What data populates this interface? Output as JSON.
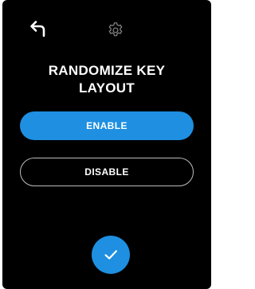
{
  "colors": {
    "background": "#000000",
    "accent": "#1e8fe1",
    "text": "#ffffff",
    "outline": "#bcbcbc"
  },
  "header": {
    "back_icon": "back-arrow-icon",
    "settings_icon": "gear-icon"
  },
  "title": {
    "line1": "RANDOMIZE KEY",
    "line2": "LAYOUT"
  },
  "options": {
    "enable_label": "ENABLE",
    "disable_label": "DISABLE",
    "selected": "ENABLE"
  },
  "footer": {
    "confirm_icon": "checkmark-icon"
  }
}
